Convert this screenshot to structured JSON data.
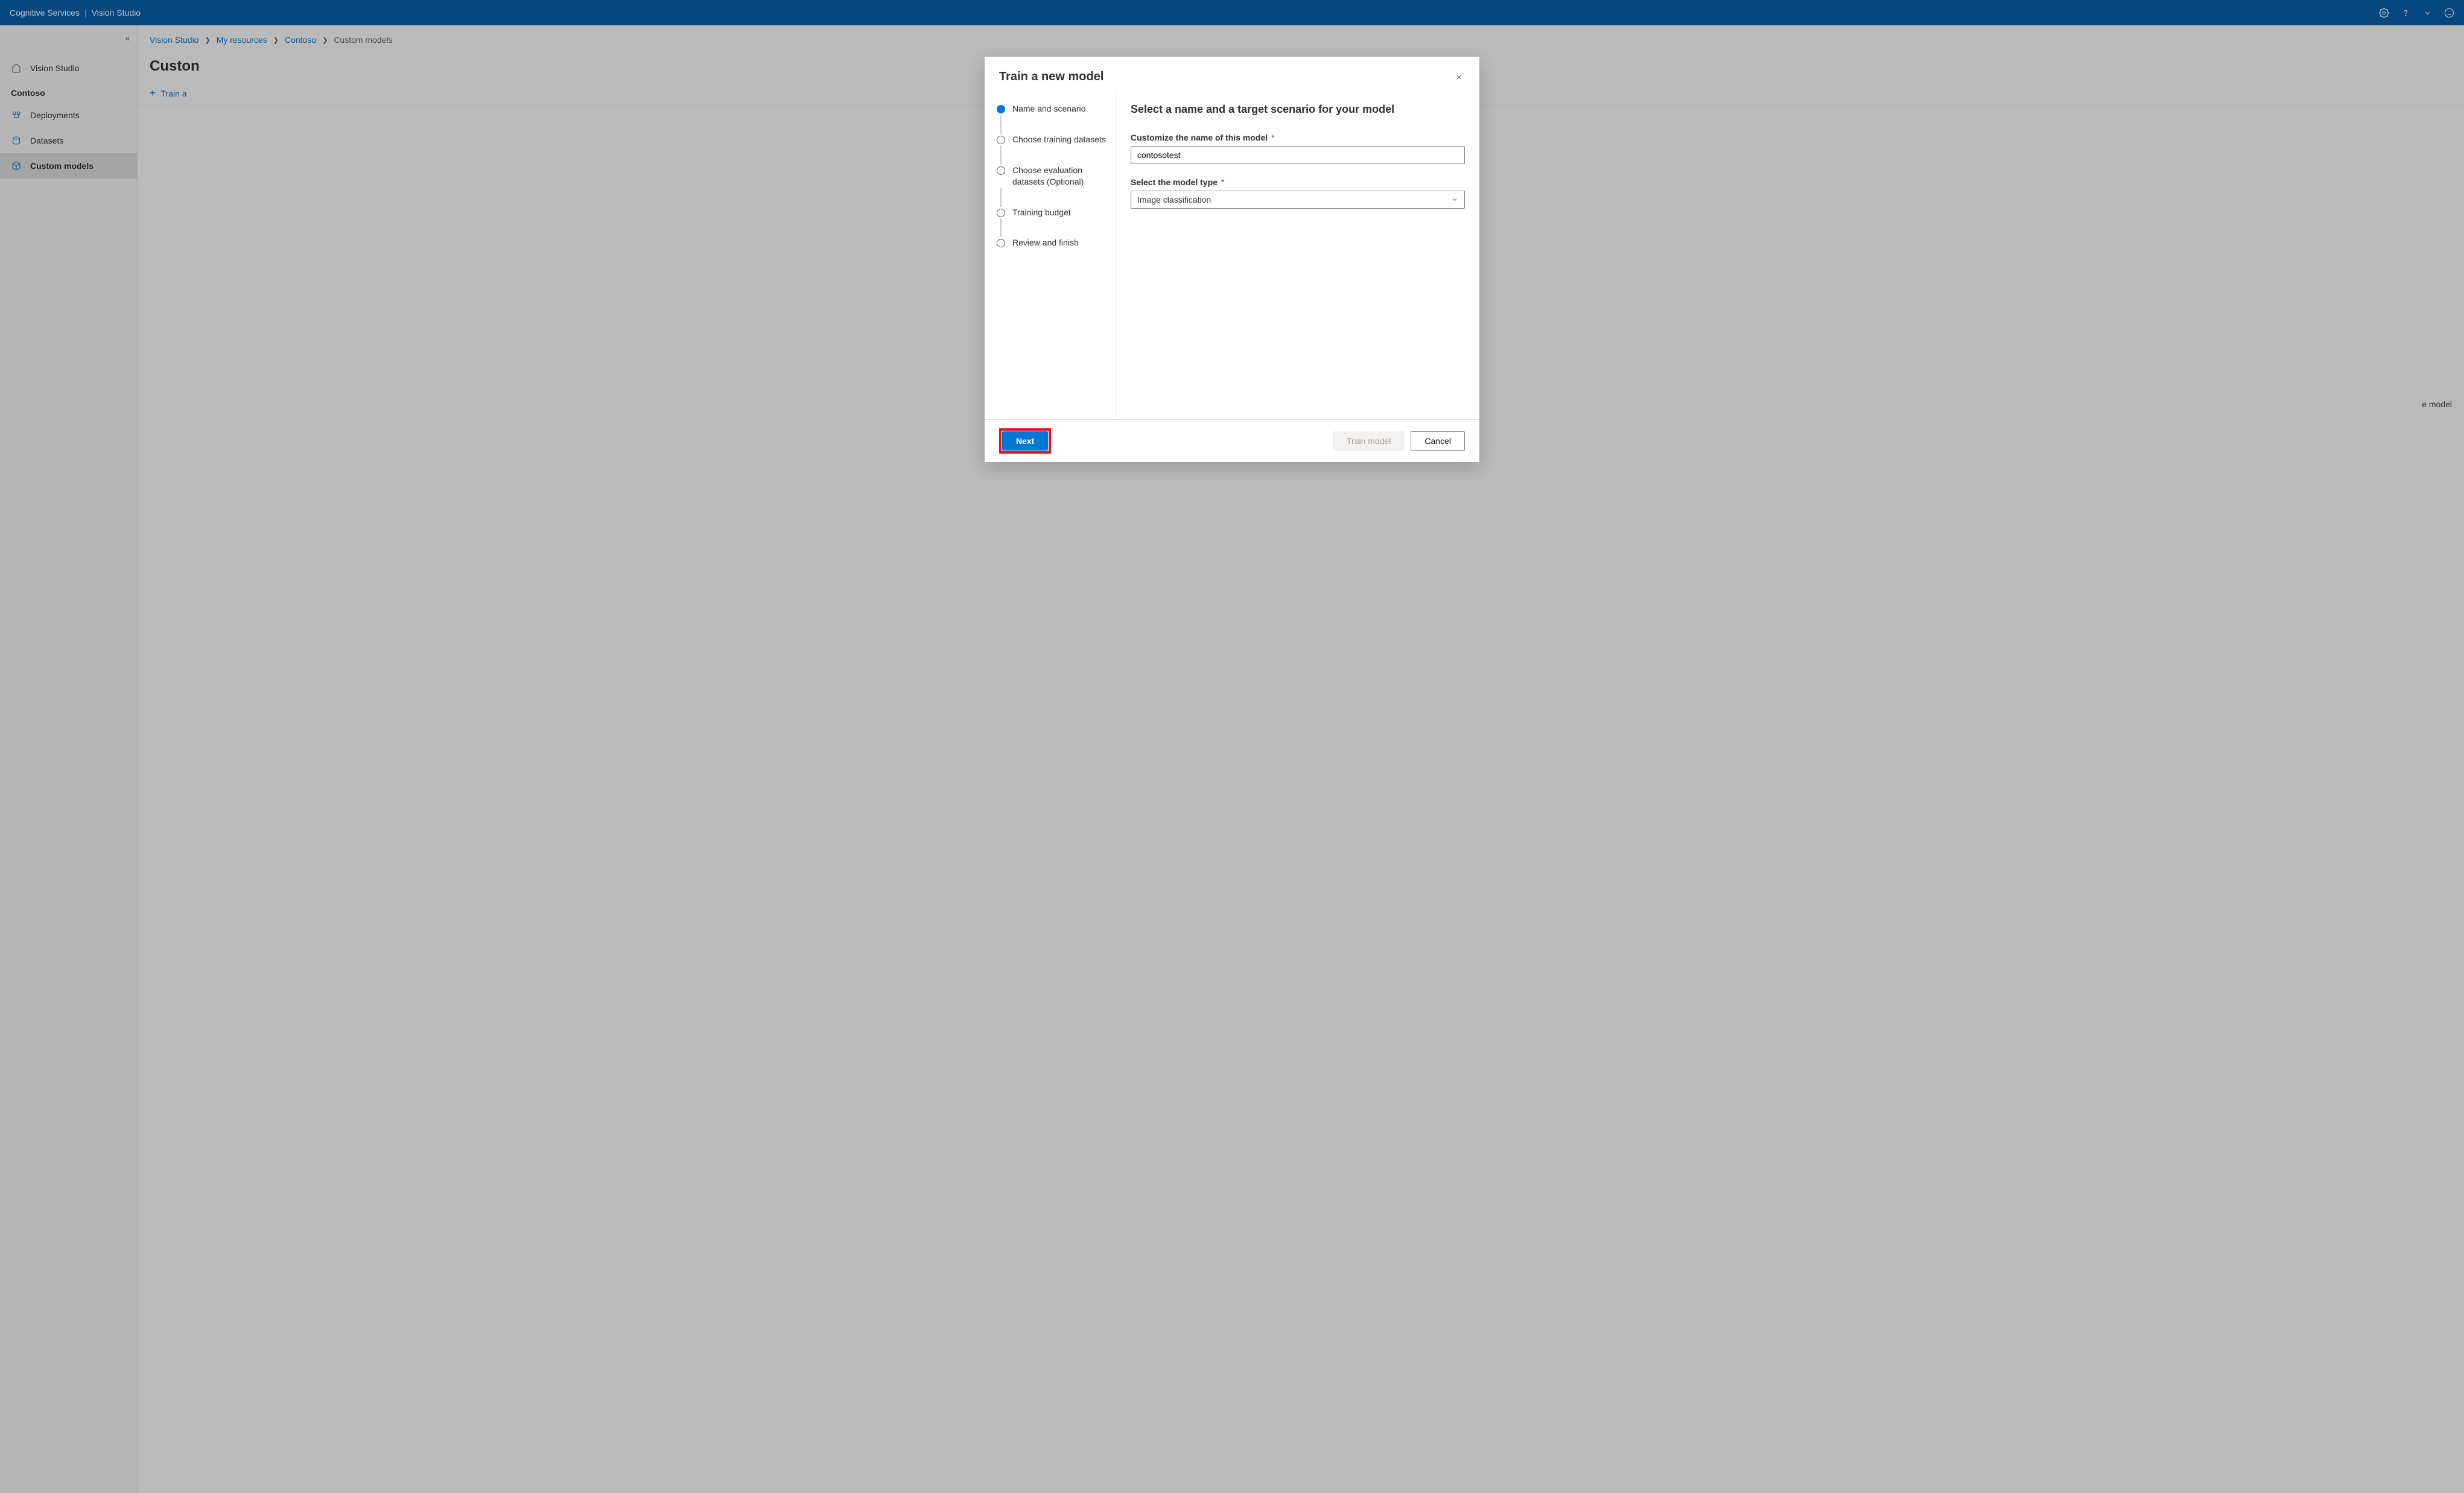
{
  "header": {
    "service": "Cognitive Services",
    "product": "Vision Studio"
  },
  "sidebar": {
    "home_label": "Vision Studio",
    "resource_label": "Contoso",
    "items": [
      {
        "label": "Deployments"
      },
      {
        "label": "Datasets"
      },
      {
        "label": "Custom models"
      }
    ]
  },
  "breadcrumb": {
    "items": [
      "Vision Studio",
      "My resources",
      "Contoso"
    ],
    "current": "Custom models"
  },
  "page": {
    "title_fragment": "Custon",
    "train_action": "Train a",
    "fragment_right": "e model"
  },
  "dialog": {
    "title": "Train a new model",
    "steps": [
      "Name and scenario",
      "Choose training datasets",
      "Choose evaluation datasets (Optional)",
      "Training budget",
      "Review and finish"
    ],
    "content": {
      "heading": "Select a name and a target scenario for your model",
      "name_label": "Customize the name of this model",
      "name_value": "contosotest",
      "type_label": "Select the model type",
      "type_value": "Image classification"
    },
    "footer": {
      "next": "Next",
      "train": "Train model",
      "cancel": "Cancel"
    }
  }
}
